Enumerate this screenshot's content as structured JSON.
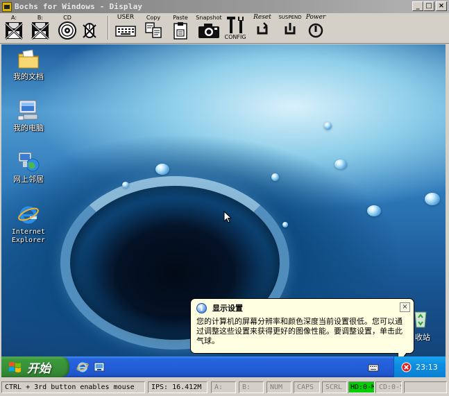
{
  "window": {
    "title": "Bochs for Windows - Display",
    "minimize_glyph": "_",
    "maximize_glyph": "□",
    "close_glyph": "×"
  },
  "toolbar": {
    "floppy_a": "A:",
    "floppy_b": "B:",
    "cdrom": "CD",
    "user": "USER",
    "copy": "Copy",
    "paste": "Paste",
    "snapshot": "Snapshot",
    "config": "CONFIG",
    "reset": "Reset",
    "suspend": "SUSPEND",
    "power": "Power"
  },
  "desktop": {
    "icons": [
      {
        "label": "我的文档"
      },
      {
        "label": "我的电脑"
      },
      {
        "label": "网上邻居"
      },
      {
        "label": "Internet Explorer"
      }
    ],
    "recycle_label": "收站"
  },
  "balloon": {
    "title": "显示设置",
    "text": "您的计算机的屏幕分辨率和颜色深度当前设置很低。您可以通过调整这些设置来获得更好的图像性能。要调整设置，单击此气球。",
    "close_glyph": "×"
  },
  "taskbar": {
    "start_label": "开始",
    "clock": "23:13"
  },
  "statusbar": {
    "hint": "CTRL + 3rd button enables mouse",
    "ips": "IPS: 16.412M",
    "a": "A:",
    "b": "B:",
    "num": "NUM",
    "caps": "CAPS",
    "scrl": "SCRL",
    "hd": "HD:0-M",
    "cd": "CD:0-S"
  }
}
